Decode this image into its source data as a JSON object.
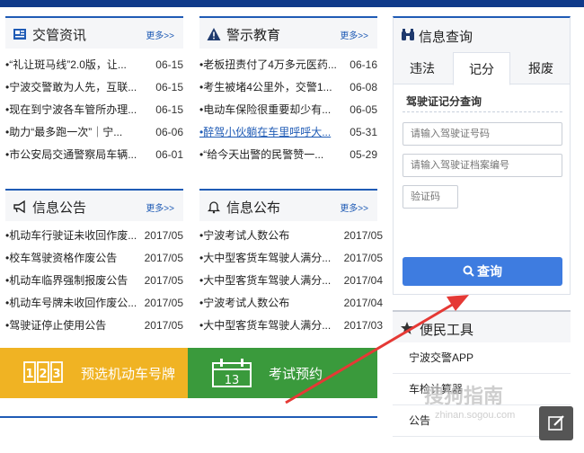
{
  "panels": {
    "traffic_news": {
      "title": "交管资讯",
      "more": "更多>>",
      "items": [
        {
          "text": "•“礼让斑马线”2.0版，让...",
          "date": "06-15"
        },
        {
          "text": "•宁波交警敢为人先，互联...",
          "date": "06-15"
        },
        {
          "text": "•现在到宁波各车管所办理...",
          "date": "06-15"
        },
        {
          "text": "•助力“最多跑一次”｜宁...",
          "date": "06-06"
        },
        {
          "text": "•市公安局交通警察局车辆...",
          "date": "06-01"
        }
      ]
    },
    "police_education": {
      "title": "警示教育",
      "more": "更多>>",
      "items": [
        {
          "text": "•老板扭责付了4万多元医药...",
          "date": "06-16"
        },
        {
          "text": "•考生被堵4公里外，交警1...",
          "date": "06-08"
        },
        {
          "text": "•电动车保险很重要却少有...",
          "date": "06-05"
        },
        {
          "text": "•醉驾小伙躺在车里呼呼大...",
          "date": "05-31"
        },
        {
          "text": "•“给今天出警的民警赞一...",
          "date": "05-29"
        }
      ]
    },
    "info_notice": {
      "title": "信息公告",
      "more": "更多>>",
      "items": [
        {
          "text": "•机动车行驶证未收回作废...",
          "date": "2017/05"
        },
        {
          "text": "•校车驾驶资格作废公告",
          "date": "2017/05"
        },
        {
          "text": "•机动车临界强制报废公告",
          "date": "2017/05"
        },
        {
          "text": "•机动车号牌未收回作废公...",
          "date": "2017/05"
        },
        {
          "text": "•驾驶证停止使用公告",
          "date": "2017/05"
        }
      ]
    },
    "info_publish": {
      "title": "信息公布",
      "more": "更多>>",
      "items": [
        {
          "text": "•宁波考试人数公布",
          "date": "2017/05"
        },
        {
          "text": "•大中型客货车驾驶人满分...",
          "date": "2017/05"
        },
        {
          "text": "•大中型客货车驾驶人满分...",
          "date": "2017/04"
        },
        {
          "text": "•宁波考试人数公布",
          "date": "2017/04"
        },
        {
          "text": "•大中型客货车驾驶人满分...",
          "date": "2017/03"
        }
      ]
    }
  },
  "banners": {
    "plate": {
      "label": "预选机动车号牌",
      "icon_text": "123",
      "color": "#f0b323"
    },
    "exam": {
      "label": "考试预约",
      "icon_text": "13",
      "color": "#3a9a3c"
    }
  },
  "query": {
    "title": "信息查询",
    "tabs": [
      "违法",
      "记分",
      "报废"
    ],
    "active_tab": "记分",
    "subtitle": "驾驶证记分查询",
    "placeholder_license": "请输入驾驶证号码",
    "placeholder_file": "请输入驾驶证档案编号",
    "placeholder_captcha": "验证码",
    "button": "查询"
  },
  "tools": {
    "title": "便民工具",
    "items": [
      "宁波交警APP",
      "车检计算器",
      "公告"
    ]
  },
  "watermark": {
    "main": "搜狗指南",
    "sub": "zhinan.sogou.com"
  },
  "colors": {
    "accent": "#1f5bb5",
    "button": "#3e7ce0",
    "plate": "#f0b323",
    "exam": "#3a9a3c",
    "arrow": "#e53935"
  }
}
